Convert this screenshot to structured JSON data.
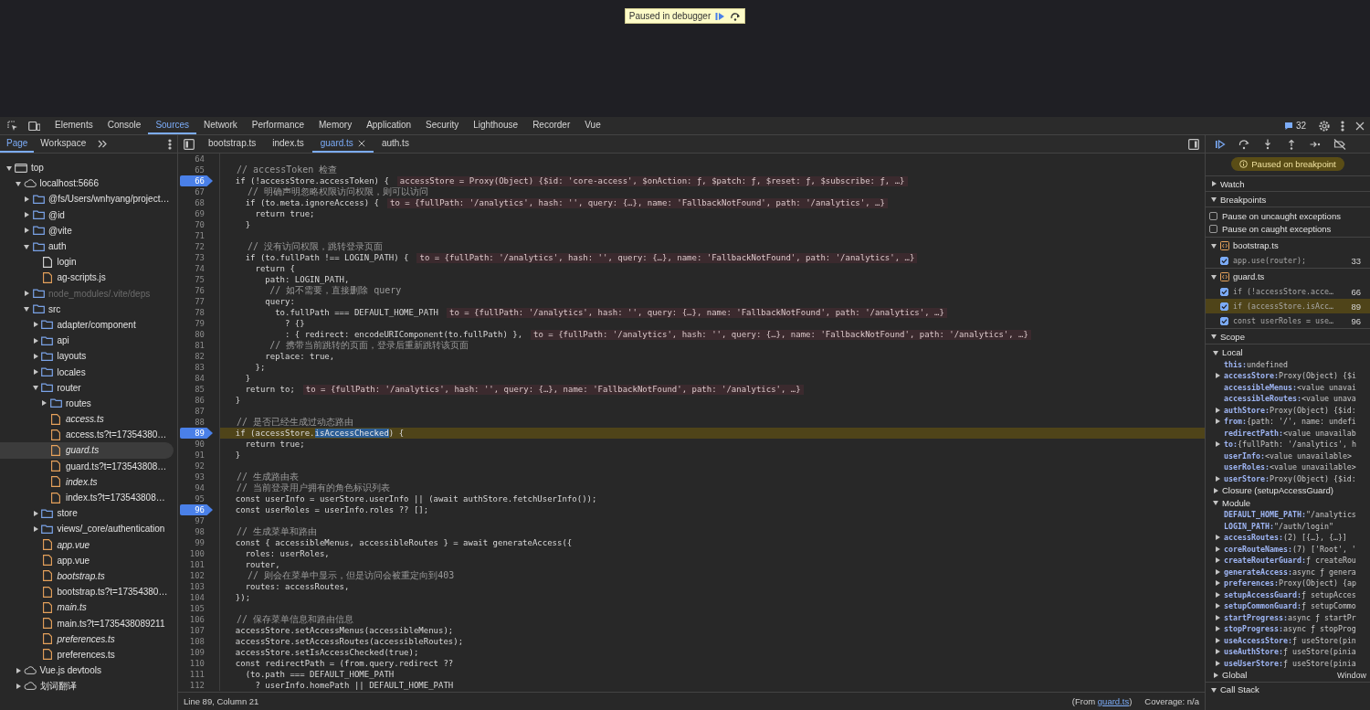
{
  "debugger_overlay": {
    "text": "Paused in debugger"
  },
  "toolbar": {
    "tabs": [
      {
        "label": "Elements",
        "selected": false
      },
      {
        "label": "Console",
        "selected": false
      },
      {
        "label": "Sources",
        "selected": true
      },
      {
        "label": "Network",
        "selected": false
      },
      {
        "label": "Performance",
        "selected": false
      },
      {
        "label": "Memory",
        "selected": false
      },
      {
        "label": "Application",
        "selected": false
      },
      {
        "label": "Security",
        "selected": false
      },
      {
        "label": "Lighthouse",
        "selected": false
      },
      {
        "label": "Recorder",
        "selected": false
      },
      {
        "label": "Vue",
        "selected": false
      }
    ],
    "issues_count": "32"
  },
  "navigator": {
    "tabs": [
      {
        "label": "Page",
        "selected": true
      },
      {
        "label": "Workspace",
        "selected": false
      }
    ],
    "tree": [
      {
        "label": "top",
        "kind": "frame",
        "expanded": true,
        "selected": false,
        "children": [
          {
            "label": "localhost:5666",
            "kind": "domain",
            "expanded": true,
            "selected": false,
            "children": [
              {
                "label": "@fs/Users/wnhyang/project…",
                "kind": "folder",
                "expanded": false,
                "selected": false,
                "ignored": false
              },
              {
                "label": "@id",
                "kind": "folder",
                "expanded": false,
                "selected": false,
                "ignored": false
              },
              {
                "label": "@vite",
                "kind": "folder",
                "expanded": false,
                "selected": false,
                "ignored": false
              },
              {
                "label": "auth",
                "kind": "folder",
                "expanded": true,
                "selected": false,
                "ignored": false,
                "children": [
                  {
                    "label": "login",
                    "kind": "document",
                    "selected": false,
                    "source_mapped": false
                  },
                  {
                    "label": "ag-scripts.js",
                    "kind": "script",
                    "selected": false,
                    "source_mapped": false
                  }
                ]
              },
              {
                "label": "node_modules/.vite/deps",
                "kind": "folder",
                "expanded": false,
                "selected": false,
                "ignored": true
              },
              {
                "label": "src",
                "kind": "folder",
                "expanded": true,
                "selected": false,
                "ignored": false,
                "children": [
                  {
                    "label": "adapter/component",
                    "kind": "folder",
                    "expanded": false,
                    "selected": false,
                    "ignored": false
                  },
                  {
                    "label": "api",
                    "kind": "folder",
                    "expanded": false,
                    "selected": false,
                    "ignored": false
                  },
                  {
                    "label": "layouts",
                    "kind": "folder",
                    "expanded": false,
                    "selected": false,
                    "ignored": false
                  },
                  {
                    "label": "locales",
                    "kind": "folder",
                    "expanded": false,
                    "selected": false,
                    "ignored": false
                  },
                  {
                    "label": "router",
                    "kind": "folder",
                    "expanded": true,
                    "selected": false,
                    "ignored": false,
                    "children": [
                      {
                        "label": "routes",
                        "kind": "folder",
                        "expanded": false,
                        "selected": false,
                        "ignored": false
                      },
                      {
                        "label": "access.ts",
                        "kind": "script",
                        "selected": false,
                        "source_mapped": true
                      },
                      {
                        "label": "access.ts?t=17354380…",
                        "kind": "script",
                        "selected": false,
                        "source_mapped": false
                      },
                      {
                        "label": "guard.ts",
                        "kind": "script",
                        "selected": true,
                        "source_mapped": true
                      },
                      {
                        "label": "guard.ts?t=173543808…",
                        "kind": "script",
                        "selected": false,
                        "source_mapped": false
                      },
                      {
                        "label": "index.ts",
                        "kind": "script",
                        "selected": false,
                        "source_mapped": true
                      },
                      {
                        "label": "index.ts?t=173543808…",
                        "kind": "script",
                        "selected": false,
                        "source_mapped": false
                      }
                    ]
                  },
                  {
                    "label": "store",
                    "kind": "folder",
                    "expanded": false,
                    "selected": false,
                    "ignored": false
                  },
                  {
                    "label": "views/_core/authentication",
                    "kind": "folder",
                    "expanded": false,
                    "selected": false,
                    "ignored": false
                  },
                  {
                    "label": "app.vue",
                    "kind": "script",
                    "selected": false,
                    "source_mapped": true
                  },
                  {
                    "label": "app.vue",
                    "kind": "script",
                    "selected": false,
                    "source_mapped": false
                  },
                  {
                    "label": "bootstrap.ts",
                    "kind": "script",
                    "selected": false,
                    "source_mapped": true
                  },
                  {
                    "label": "bootstrap.ts?t=17354380…",
                    "kind": "script",
                    "selected": false,
                    "source_mapped": false
                  },
                  {
                    "label": "main.ts",
                    "kind": "script",
                    "selected": false,
                    "source_mapped": true
                  },
                  {
                    "label": "main.ts?t=1735438089211",
                    "kind": "script",
                    "selected": false,
                    "source_mapped": false
                  },
                  {
                    "label": "preferences.ts",
                    "kind": "script",
                    "selected": false,
                    "source_mapped": true
                  },
                  {
                    "label": "preferences.ts",
                    "kind": "script",
                    "selected": false,
                    "source_mapped": false
                  }
                ]
              }
            ]
          },
          {
            "label": "Vue.js devtools",
            "kind": "domain",
            "expanded": false,
            "selected": false
          },
          {
            "label": "划词翻译",
            "kind": "domain",
            "expanded": false,
            "selected": false
          }
        ]
      }
    ]
  },
  "editor": {
    "tabs": [
      {
        "label": "bootstrap.ts",
        "selected": false
      },
      {
        "label": "index.ts",
        "selected": false
      },
      {
        "label": "guard.ts",
        "selected": true
      },
      {
        "label": "auth.ts",
        "selected": false
      }
    ],
    "lines": [
      {
        "number": "64",
        "breakpoint": false,
        "current": false
      },
      {
        "number": "65",
        "kind": "comment",
        "text": "  // accessToken 检查",
        "breakpoint": false,
        "current": false
      },
      {
        "number": "66",
        "kind": "code",
        "text": "  if (!accessStore.accessToken) {",
        "inline_value": "accessStore = Proxy(Object) {$id: 'core-access', $onAction: ƒ, $patch: ƒ, $reset: ƒ, $subscribe: ƒ, …}",
        "breakpoint": true,
        "current": false
      },
      {
        "number": "67",
        "kind": "comment",
        "text": "    // 明确声明忽略权限访问权限，则可以访问",
        "breakpoint": false,
        "current": false
      },
      {
        "number": "68",
        "kind": "code",
        "text": "    if (to.meta.ignoreAccess) {",
        "inline_value": "to = {fullPath: '/analytics', hash: '', query: {…}, name: 'FallbackNotFound', path: '/analytics', …}",
        "breakpoint": false,
        "current": false
      },
      {
        "number": "69",
        "kind": "code",
        "text": "      return true;",
        "breakpoint": false,
        "current": false
      },
      {
        "number": "70",
        "kind": "code",
        "text": "    }",
        "breakpoint": false,
        "current": false
      },
      {
        "number": "71",
        "breakpoint": false,
        "current": false
      },
      {
        "number": "72",
        "kind": "comment",
        "text": "    // 没有访问权限，跳转登录页面",
        "breakpoint": false,
        "current": false
      },
      {
        "number": "73",
        "kind": "code",
        "text": "    if (to.fullPath !== LOGIN_PATH) {",
        "inline_value": "to = {fullPath: '/analytics', hash: '', query: {…}, name: 'FallbackNotFound', path: '/analytics', …}",
        "breakpoint": false,
        "current": false
      },
      {
        "number": "74",
        "kind": "code",
        "text": "      return {",
        "breakpoint": false,
        "current": false
      },
      {
        "number": "75",
        "kind": "code",
        "text": "        path: LOGIN_PATH,",
        "breakpoint": false,
        "current": false
      },
      {
        "number": "76",
        "kind": "comment",
        "text": "        // 如不需要，直接删除 query",
        "breakpoint": false,
        "current": false
      },
      {
        "number": "77",
        "kind": "code",
        "text": "        query:",
        "breakpoint": false,
        "current": false
      },
      {
        "number": "78",
        "kind": "code",
        "text": "          to.fullPath === DEFAULT_HOME_PATH",
        "inline_value": "to = {fullPath: '/analytics', hash: '', query: {…}, name: 'FallbackNotFound', path: '/analytics', …}",
        "breakpoint": false,
        "current": false
      },
      {
        "number": "79",
        "kind": "code",
        "text": "            ? {}",
        "breakpoint": false,
        "current": false
      },
      {
        "number": "80",
        "kind": "code",
        "text": "            : { redirect: encodeURIComponent(to.fullPath) },",
        "inline_value": "to = {fullPath: '/analytics', hash: '', query: {…}, name: 'FallbackNotFound', path: '/analytics', …}",
        "breakpoint": false,
        "current": false
      },
      {
        "number": "81",
        "kind": "comment",
        "text": "        // 携带当前跳转的页面，登录后重新跳转该页面",
        "breakpoint": false,
        "current": false
      },
      {
        "number": "82",
        "kind": "code",
        "text": "        replace: true,",
        "breakpoint": false,
        "current": false
      },
      {
        "number": "83",
        "kind": "code",
        "text": "      };",
        "breakpoint": false,
        "current": false
      },
      {
        "number": "84",
        "kind": "code",
        "text": "    }",
        "breakpoint": false,
        "current": false
      },
      {
        "number": "85",
        "kind": "code",
        "text": "    return to;",
        "inline_value": "to = {fullPath: '/analytics', hash: '', query: {…}, name: 'FallbackNotFound', path: '/analytics', …}",
        "breakpoint": false,
        "current": false
      },
      {
        "number": "86",
        "kind": "code",
        "text": "  }",
        "breakpoint": false,
        "current": false
      },
      {
        "number": "87",
        "breakpoint": false,
        "current": false
      },
      {
        "number": "88",
        "kind": "comment",
        "text": "  // 是否已经生成过动态路由",
        "breakpoint": false,
        "current": false
      },
      {
        "number": "89",
        "kind": "code",
        "text": "  if (accessStore.",
        "selection": "isAccessChecked",
        "text_after": ") {",
        "breakpoint": true,
        "current": true
      },
      {
        "number": "90",
        "kind": "code",
        "text": "    return true;",
        "breakpoint": false,
        "current": false
      },
      {
        "number": "91",
        "kind": "code",
        "text": "  }",
        "breakpoint": false,
        "current": false
      },
      {
        "number": "92",
        "breakpoint": false,
        "current": false
      },
      {
        "number": "93",
        "kind": "comment",
        "text": "  // 生成路由表",
        "breakpoint": false,
        "current": false
      },
      {
        "number": "94",
        "kind": "comment",
        "text": "  // 当前登录用户拥有的角色标识列表",
        "breakpoint": false,
        "current": false
      },
      {
        "number": "95",
        "kind": "code",
        "text": "  const userInfo = userStore.userInfo || (await authStore.fetchUserInfo());",
        "breakpoint": false,
        "current": false
      },
      {
        "number": "96",
        "kind": "code",
        "text": "  const userRoles = userInfo.roles ?? [];",
        "breakpoint": true,
        "current": false
      },
      {
        "number": "97",
        "breakpoint": false,
        "current": false
      },
      {
        "number": "98",
        "kind": "comment",
        "text": "  // 生成菜单和路由",
        "breakpoint": false,
        "current": false
      },
      {
        "number": "99",
        "kind": "code",
        "text": "  const { accessibleMenus, accessibleRoutes } = await generateAccess({",
        "breakpoint": false,
        "current": false
      },
      {
        "number": "100",
        "kind": "code",
        "text": "    roles: userRoles,",
        "breakpoint": false,
        "current": false
      },
      {
        "number": "101",
        "kind": "code",
        "text": "    router,",
        "breakpoint": false,
        "current": false
      },
      {
        "number": "102",
        "kind": "comment",
        "text": "    // 则会在菜单中显示，但是访问会被重定向到403",
        "breakpoint": false,
        "current": false
      },
      {
        "number": "103",
        "kind": "code",
        "text": "    routes: accessRoutes,",
        "breakpoint": false,
        "current": false
      },
      {
        "number": "104",
        "kind": "code",
        "text": "  });",
        "breakpoint": false,
        "current": false
      },
      {
        "number": "105",
        "breakpoint": false,
        "current": false
      },
      {
        "number": "106",
        "kind": "comment",
        "text": "  // 保存菜单信息和路由信息",
        "breakpoint": false,
        "current": false
      },
      {
        "number": "107",
        "kind": "code",
        "text": "  accessStore.setAccessMenus(accessibleMenus);",
        "breakpoint": false,
        "current": false
      },
      {
        "number": "108",
        "kind": "code",
        "text": "  accessStore.setAccessRoutes(accessibleRoutes);",
        "breakpoint": false,
        "current": false
      },
      {
        "number": "109",
        "kind": "code",
        "text": "  accessStore.setIsAccessChecked(true);",
        "breakpoint": false,
        "current": false
      },
      {
        "number": "110",
        "kind": "code",
        "text": "  const redirectPath = (from.query.redirect ??",
        "breakpoint": false,
        "current": false
      },
      {
        "number": "111",
        "kind": "code",
        "text": "    (to.path === DEFAULT_HOME_PATH",
        "breakpoint": false,
        "current": false
      },
      {
        "number": "112",
        "kind": "code",
        "text": "      ? userInfo.homePath || DEFAULT_HOME_PATH",
        "breakpoint": false,
        "current": false
      }
    ],
    "status": {
      "position": "Line 89, Column 21",
      "from_open": "(From",
      "from_link": "guard.ts",
      "from_close": ")",
      "coverage": "Coverage: n/a"
    }
  },
  "sidebar": {
    "banner": "Paused on breakpoint",
    "sections": [
      {
        "kind": "watch",
        "title": "Watch",
        "expanded": false
      },
      {
        "kind": "breakpoints",
        "title": "Breakpoints",
        "expanded": true,
        "pause_options": [
          {
            "label": "Pause on uncaught exceptions",
            "checked": false
          },
          {
            "label": "Pause on caught exceptions",
            "checked": false
          }
        ],
        "files": [
          {
            "name": "bootstrap.ts",
            "expanded": true,
            "breakpoints": [
              {
                "code": "app.use(router);",
                "line": "33",
                "checked": true,
                "current": false
              }
            ]
          },
          {
            "name": "guard.ts",
            "expanded": true,
            "breakpoints": [
              {
                "code": "if (!accessStore.acce…",
                "line": "66",
                "checked": true,
                "current": false
              },
              {
                "code": "if (accessStore.isAcc…",
                "line": "89",
                "checked": true,
                "current": true
              },
              {
                "code": "const userRoles = use…",
                "line": "96",
                "checked": true,
                "current": false
              }
            ]
          }
        ]
      },
      {
        "kind": "scope",
        "title": "Scope",
        "expanded": true,
        "scopes": [
          {
            "title": "Local",
            "expanded": true,
            "entries": [
              {
                "name": "this:",
                "value": "undefined",
                "expandable": false
              },
              {
                "name": "accessStore:",
                "value": "Proxy(Object) {$i",
                "expandable": true
              },
              {
                "name": "accessibleMenus:",
                "value": "<value unavai",
                "expandable": false
              },
              {
                "name": "accessibleRoutes:",
                "value": "<value unava",
                "expandable": false
              },
              {
                "name": "authStore:",
                "value": "Proxy(Object) {$id:",
                "expandable": true
              },
              {
                "name": "from:",
                "value": "{path: '/', name: undefi",
                "expandable": true
              },
              {
                "name": "redirectPath:",
                "value": "<value unavailab",
                "expandable": false
              },
              {
                "name": "to:",
                "value": "{fullPath: '/analytics', h",
                "expandable": true
              },
              {
                "name": "userInfo:",
                "value": "<value unavailable>",
                "expandable": false
              },
              {
                "name": "userRoles:",
                "value": "<value unavailable>",
                "expandable": false
              },
              {
                "name": "userStore:",
                "value": "Proxy(Object) {$id:",
                "expandable": true
              }
            ]
          },
          {
            "title": "Closure (setupAccessGuard)",
            "expanded": false
          },
          {
            "title": "Module",
            "expanded": true,
            "entries": [
              {
                "name": "DEFAULT_HOME_PATH:",
                "value": "\"/analytics",
                "expandable": false
              },
              {
                "name": "LOGIN_PATH:",
                "value": "\"/auth/login\"",
                "expandable": false
              },
              {
                "name": "accessRoutes:",
                "value": "(2) [{…}, {…}]",
                "expandable": true
              },
              {
                "name": "coreRouteNames:",
                "value": "(7) ['Root', '",
                "expandable": true
              },
              {
                "name": "createRouterGuard:",
                "value": "ƒ createRou",
                "expandable": true
              },
              {
                "name": "generateAccess:",
                "value": "async ƒ genera",
                "expandable": true
              },
              {
                "name": "preferences:",
                "value": "Proxy(Object) {ap",
                "expandable": true
              },
              {
                "name": "setupAccessGuard:",
                "value": "ƒ setupAcces",
                "expandable": true
              },
              {
                "name": "setupCommonGuard:",
                "value": "ƒ setupCommo",
                "expandable": true
              },
              {
                "name": "startProgress:",
                "value": "async ƒ startPr",
                "expandable": true
              },
              {
                "name": "stopProgress:",
                "value": "async ƒ stopProg",
                "expandable": true
              },
              {
                "name": "useAccessStore:",
                "value": "ƒ useStore(pin",
                "expandable": true
              },
              {
                "name": "useAuthStore:",
                "value": "ƒ useStore(pinia",
                "expandable": true
              },
              {
                "name": "useUserStore:",
                "value": "ƒ useStore(pinia",
                "expandable": true
              }
            ]
          },
          {
            "title": "Global",
            "expanded": false,
            "value": "Window"
          }
        ]
      },
      {
        "kind": "call_stack",
        "title": "Call Stack",
        "expanded": true
      }
    ]
  }
}
